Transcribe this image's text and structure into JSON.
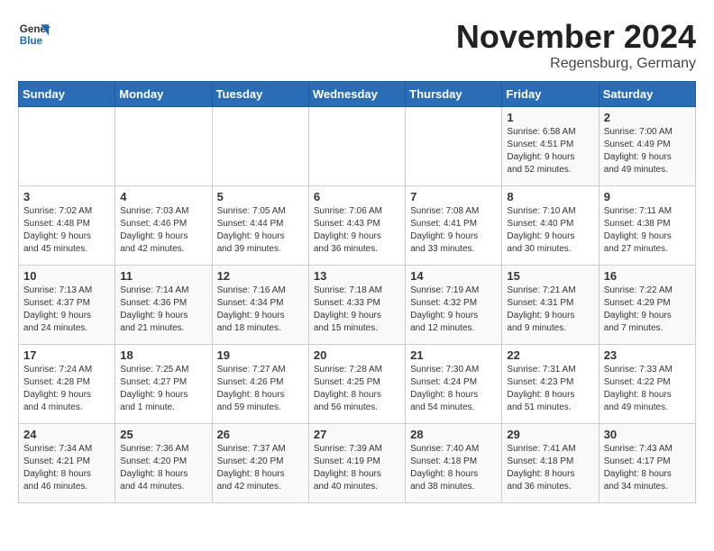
{
  "header": {
    "logo_general": "General",
    "logo_blue": "Blue",
    "month_title": "November 2024",
    "subtitle": "Regensburg, Germany"
  },
  "days_of_week": [
    "Sunday",
    "Monday",
    "Tuesday",
    "Wednesday",
    "Thursday",
    "Friday",
    "Saturday"
  ],
  "weeks": [
    [
      {
        "day": "",
        "info": ""
      },
      {
        "day": "",
        "info": ""
      },
      {
        "day": "",
        "info": ""
      },
      {
        "day": "",
        "info": ""
      },
      {
        "day": "",
        "info": ""
      },
      {
        "day": "1",
        "info": "Sunrise: 6:58 AM\nSunset: 4:51 PM\nDaylight: 9 hours\nand 52 minutes."
      },
      {
        "day": "2",
        "info": "Sunrise: 7:00 AM\nSunset: 4:49 PM\nDaylight: 9 hours\nand 49 minutes."
      }
    ],
    [
      {
        "day": "3",
        "info": "Sunrise: 7:02 AM\nSunset: 4:48 PM\nDaylight: 9 hours\nand 45 minutes."
      },
      {
        "day": "4",
        "info": "Sunrise: 7:03 AM\nSunset: 4:46 PM\nDaylight: 9 hours\nand 42 minutes."
      },
      {
        "day": "5",
        "info": "Sunrise: 7:05 AM\nSunset: 4:44 PM\nDaylight: 9 hours\nand 39 minutes."
      },
      {
        "day": "6",
        "info": "Sunrise: 7:06 AM\nSunset: 4:43 PM\nDaylight: 9 hours\nand 36 minutes."
      },
      {
        "day": "7",
        "info": "Sunrise: 7:08 AM\nSunset: 4:41 PM\nDaylight: 9 hours\nand 33 minutes."
      },
      {
        "day": "8",
        "info": "Sunrise: 7:10 AM\nSunset: 4:40 PM\nDaylight: 9 hours\nand 30 minutes."
      },
      {
        "day": "9",
        "info": "Sunrise: 7:11 AM\nSunset: 4:38 PM\nDaylight: 9 hours\nand 27 minutes."
      }
    ],
    [
      {
        "day": "10",
        "info": "Sunrise: 7:13 AM\nSunset: 4:37 PM\nDaylight: 9 hours\nand 24 minutes."
      },
      {
        "day": "11",
        "info": "Sunrise: 7:14 AM\nSunset: 4:36 PM\nDaylight: 9 hours\nand 21 minutes."
      },
      {
        "day": "12",
        "info": "Sunrise: 7:16 AM\nSunset: 4:34 PM\nDaylight: 9 hours\nand 18 minutes."
      },
      {
        "day": "13",
        "info": "Sunrise: 7:18 AM\nSunset: 4:33 PM\nDaylight: 9 hours\nand 15 minutes."
      },
      {
        "day": "14",
        "info": "Sunrise: 7:19 AM\nSunset: 4:32 PM\nDaylight: 9 hours\nand 12 minutes."
      },
      {
        "day": "15",
        "info": "Sunrise: 7:21 AM\nSunset: 4:31 PM\nDaylight: 9 hours\nand 9 minutes."
      },
      {
        "day": "16",
        "info": "Sunrise: 7:22 AM\nSunset: 4:29 PM\nDaylight: 9 hours\nand 7 minutes."
      }
    ],
    [
      {
        "day": "17",
        "info": "Sunrise: 7:24 AM\nSunset: 4:28 PM\nDaylight: 9 hours\nand 4 minutes."
      },
      {
        "day": "18",
        "info": "Sunrise: 7:25 AM\nSunset: 4:27 PM\nDaylight: 9 hours\nand 1 minute."
      },
      {
        "day": "19",
        "info": "Sunrise: 7:27 AM\nSunset: 4:26 PM\nDaylight: 8 hours\nand 59 minutes."
      },
      {
        "day": "20",
        "info": "Sunrise: 7:28 AM\nSunset: 4:25 PM\nDaylight: 8 hours\nand 56 minutes."
      },
      {
        "day": "21",
        "info": "Sunrise: 7:30 AM\nSunset: 4:24 PM\nDaylight: 8 hours\nand 54 minutes."
      },
      {
        "day": "22",
        "info": "Sunrise: 7:31 AM\nSunset: 4:23 PM\nDaylight: 8 hours\nand 51 minutes."
      },
      {
        "day": "23",
        "info": "Sunrise: 7:33 AM\nSunset: 4:22 PM\nDaylight: 8 hours\nand 49 minutes."
      }
    ],
    [
      {
        "day": "24",
        "info": "Sunrise: 7:34 AM\nSunset: 4:21 PM\nDaylight: 8 hours\nand 46 minutes."
      },
      {
        "day": "25",
        "info": "Sunrise: 7:36 AM\nSunset: 4:20 PM\nDaylight: 8 hours\nand 44 minutes."
      },
      {
        "day": "26",
        "info": "Sunrise: 7:37 AM\nSunset: 4:20 PM\nDaylight: 8 hours\nand 42 minutes."
      },
      {
        "day": "27",
        "info": "Sunrise: 7:39 AM\nSunset: 4:19 PM\nDaylight: 8 hours\nand 40 minutes."
      },
      {
        "day": "28",
        "info": "Sunrise: 7:40 AM\nSunset: 4:18 PM\nDaylight: 8 hours\nand 38 minutes."
      },
      {
        "day": "29",
        "info": "Sunrise: 7:41 AM\nSunset: 4:18 PM\nDaylight: 8 hours\nand 36 minutes."
      },
      {
        "day": "30",
        "info": "Sunrise: 7:43 AM\nSunset: 4:17 PM\nDaylight: 8 hours\nand 34 minutes."
      }
    ]
  ]
}
